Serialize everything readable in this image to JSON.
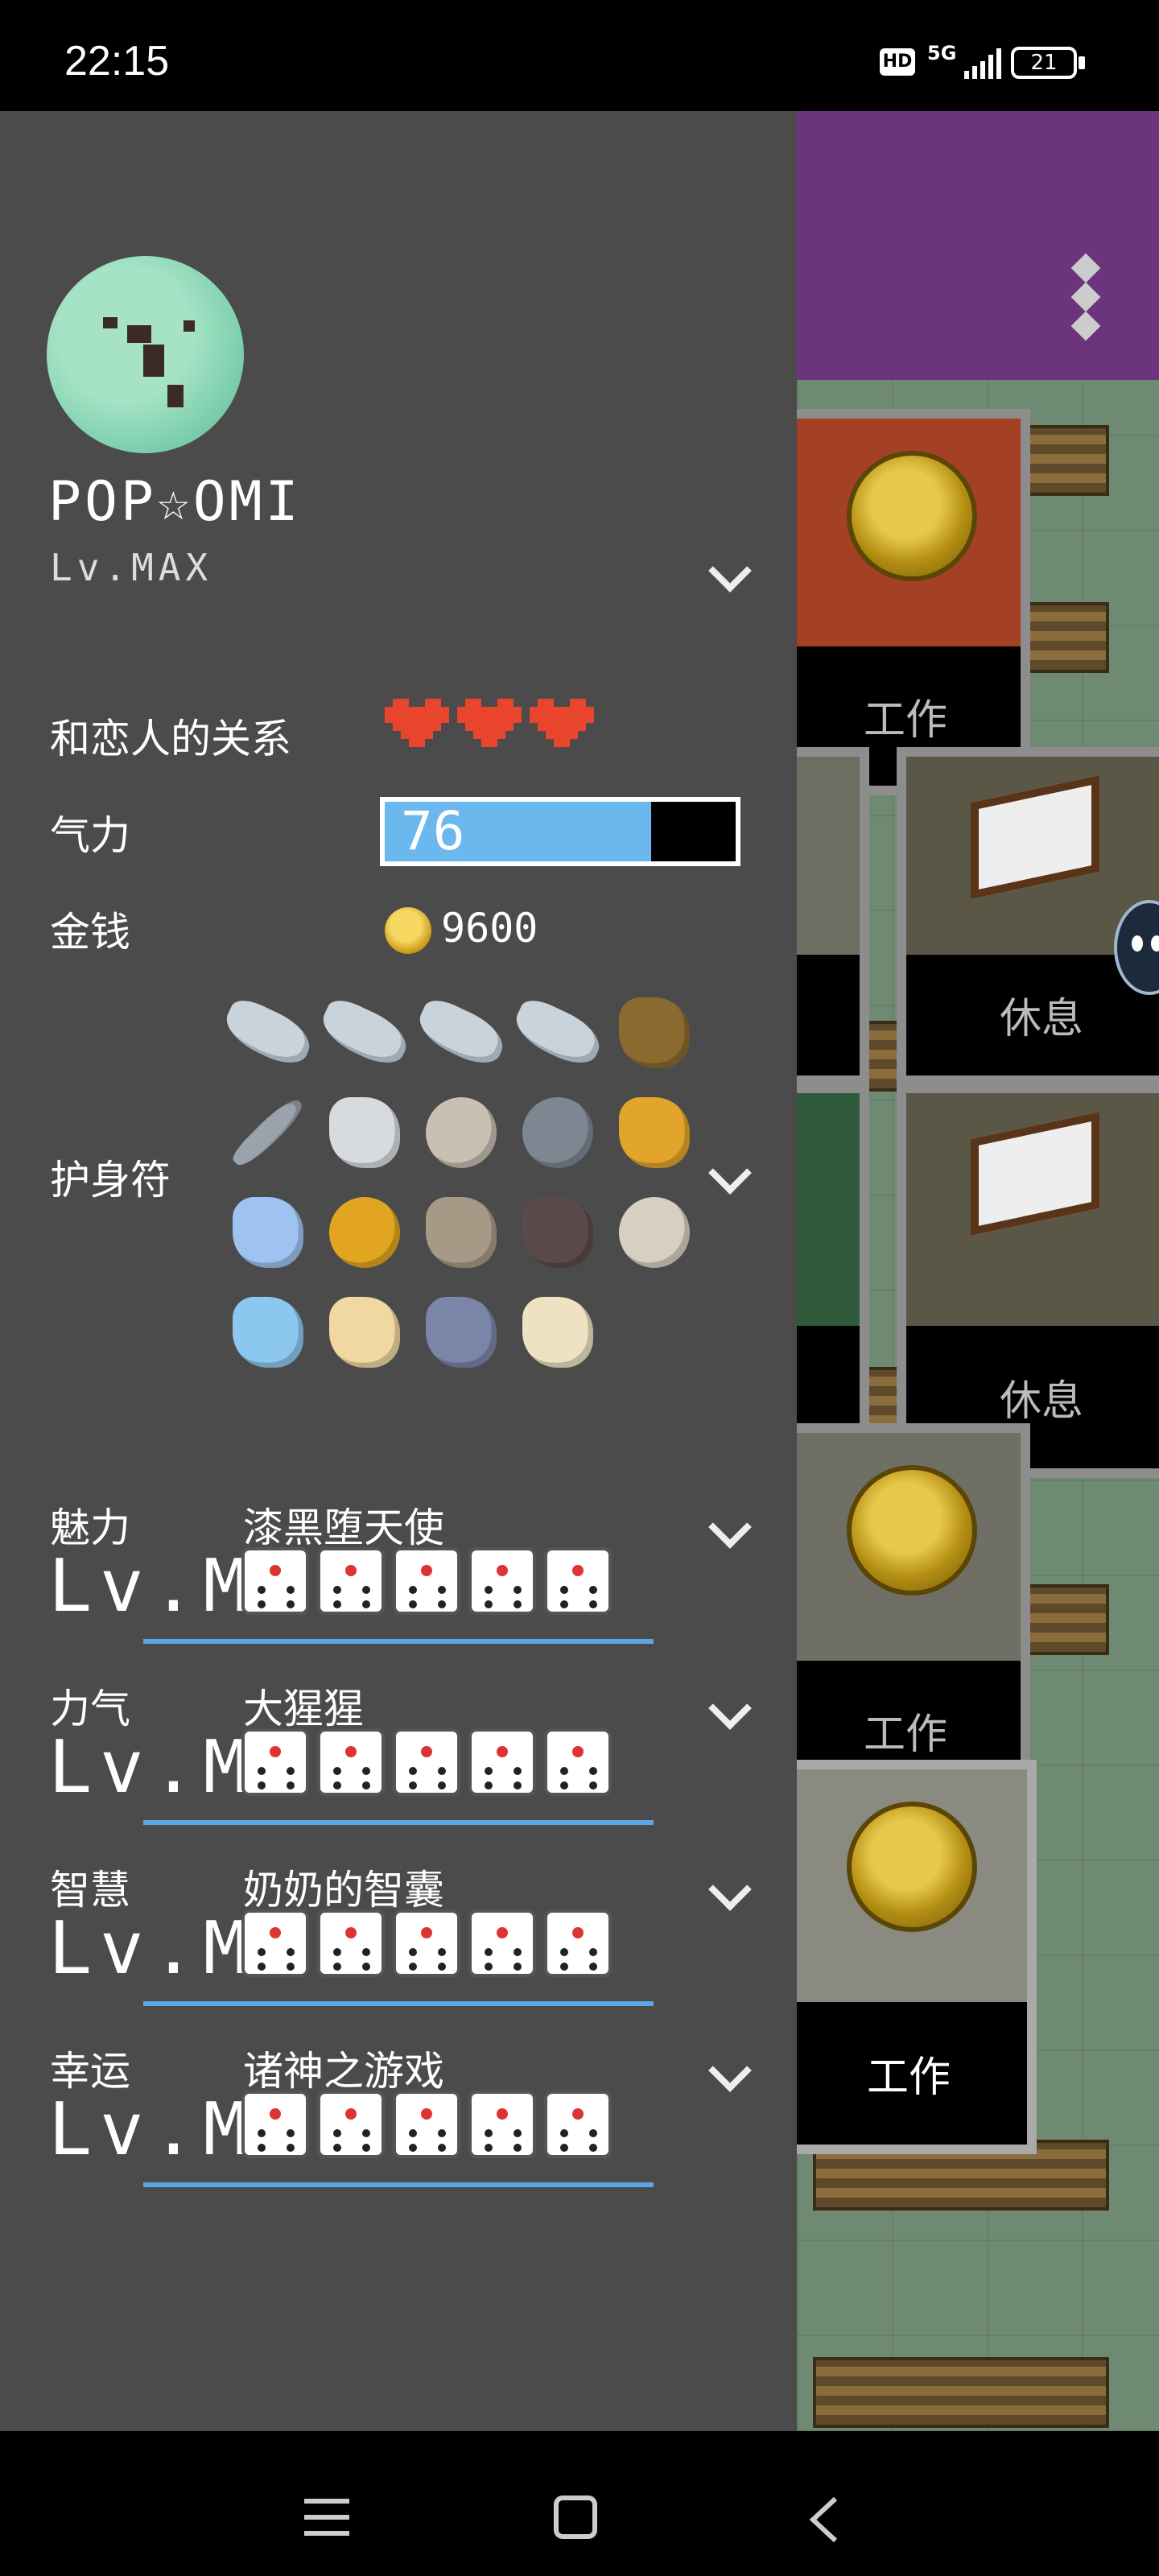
{
  "status_bar": {
    "time": "22:15",
    "network": "5G",
    "hd": "HD",
    "battery": "21"
  },
  "drawer": {
    "username": "POP☆OMI",
    "level": "Lv.MAX",
    "relation_label": "和恋人的关系",
    "hearts": 3,
    "stamina_label": "气力",
    "stamina_value": "76",
    "stamina_fraction": 0.76,
    "money_label": "金钱",
    "money_value": "9600",
    "amulet_label": "护身符",
    "amulets": [
      "tuna-fish-icon",
      "tuna-fish-icon",
      "tuna-fish-icon",
      "tuna-fish-icon",
      "branch-icon",
      "sword-icon",
      "crown-icon",
      "fossil-stone-icon",
      "silver-coin-icon",
      "heart-crown-icon",
      "tiara-icon",
      "amber-leaf-icon",
      "bone-icon",
      "bat-icon",
      "starfish-stone-icon",
      "whale-icon",
      "puppy-icon",
      "phone-gem-icon",
      "coral-icon"
    ],
    "stats": [
      {
        "name": "魅力",
        "title": "漆黑堕天使",
        "level": "Lv.MA"
      },
      {
        "name": "力气",
        "title": "大猩猩",
        "level": "Lv.MA"
      },
      {
        "name": "智慧",
        "title": "奶奶的智囊",
        "level": "Lv.MA"
      },
      {
        "name": "幸运",
        "title": "诸神之游戏",
        "level": "Lv.MA"
      }
    ]
  },
  "game": {
    "tiles": [
      "工作",
      "休息",
      "休息",
      "工作",
      "工作"
    ]
  },
  "colors": {
    "drawer_bg": "#4b4b4b",
    "stamina_fill": "#6ab8ee",
    "header_purple": "#6c347d",
    "stat_line": "#5aa6e6"
  }
}
